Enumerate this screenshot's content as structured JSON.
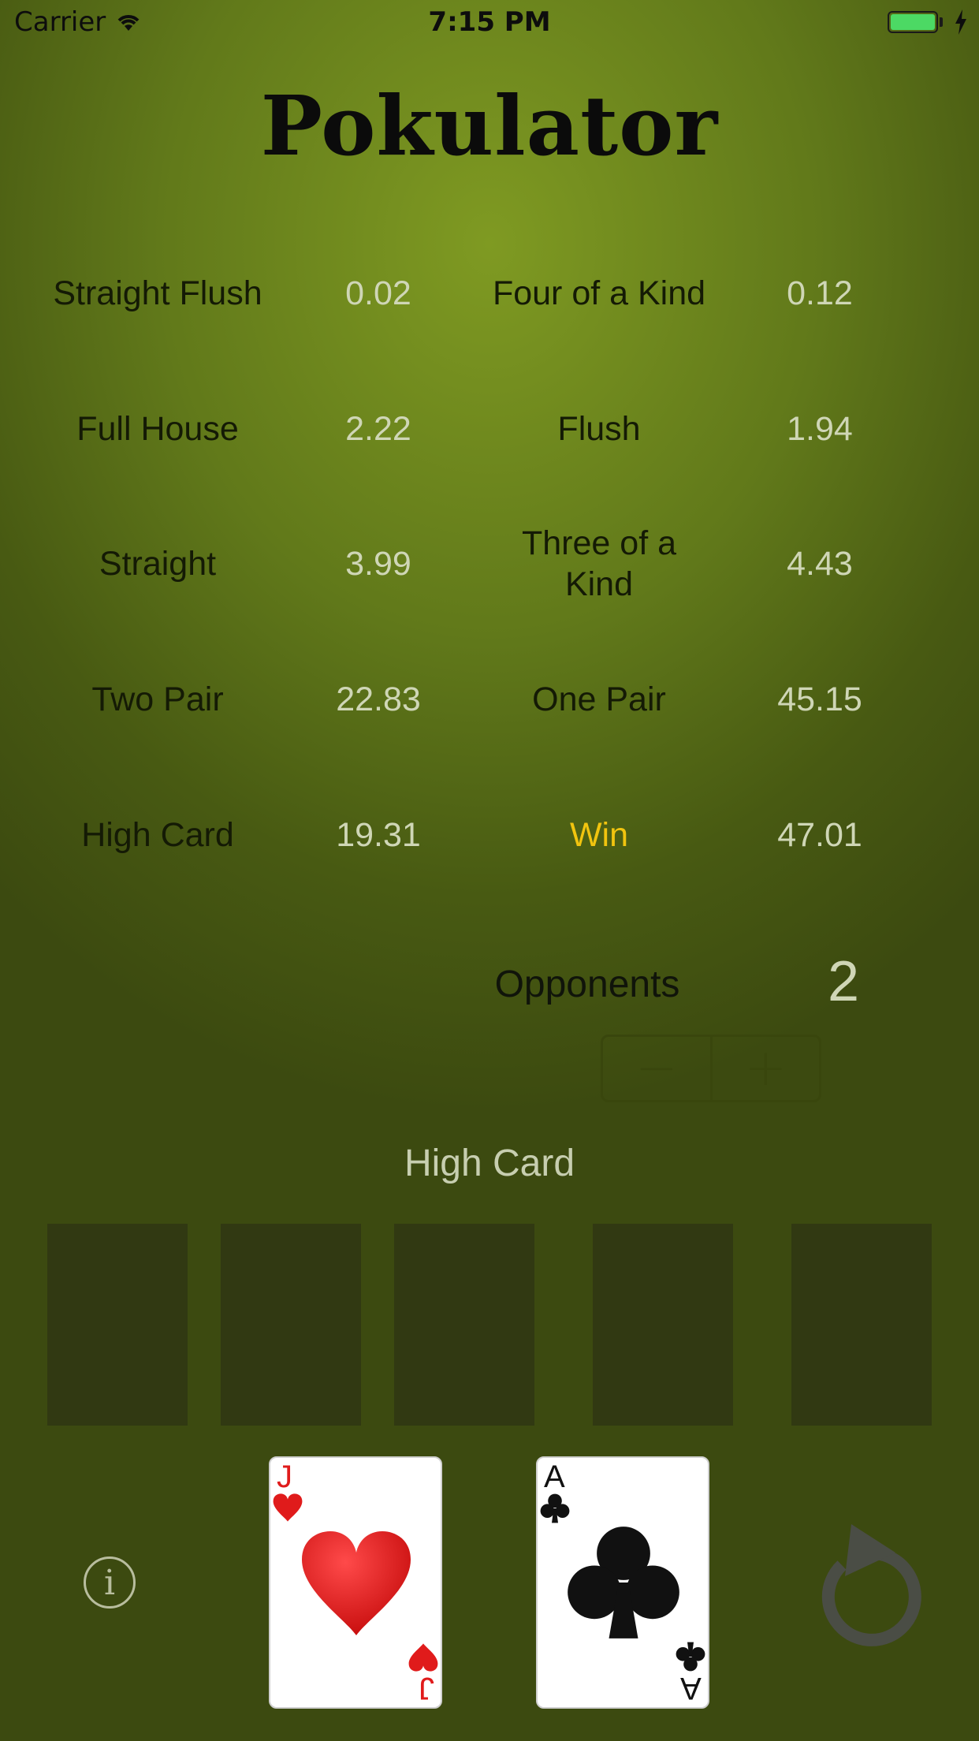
{
  "status_bar": {
    "carrier": "Carrier",
    "time": "7:15 PM",
    "battery_color": "#4cd964"
  },
  "app_title": "Pokulator",
  "odds": [
    {
      "label": "Straight Flush",
      "value": "0.02"
    },
    {
      "label": "Four of a Kind",
      "value": "0.12"
    },
    {
      "label": "Full House",
      "value": "2.22"
    },
    {
      "label": "Flush",
      "value": "1.94"
    },
    {
      "label": "Straight",
      "value": "3.99"
    },
    {
      "label": "Three of a Kind",
      "value": "4.43"
    },
    {
      "label": "Two Pair",
      "value": "22.83"
    },
    {
      "label": "One Pair",
      "value": "45.15"
    },
    {
      "label": "High Card",
      "value": "19.31"
    },
    {
      "label": "Win",
      "value": "47.01"
    }
  ],
  "accent_color": "#f1c40f",
  "opponents": {
    "label": "Opponents",
    "value": "2",
    "decrement": "−",
    "increment": "+"
  },
  "current_hand": "High Card",
  "community_slots": [
    "empty",
    "empty",
    "empty",
    "empty",
    "empty"
  ],
  "hole_cards": [
    {
      "rank": "J",
      "suit": "heart",
      "suit_symbol": "♥",
      "color": "#e01b1b"
    },
    {
      "rank": "A",
      "suit": "club",
      "suit_symbol": "♣",
      "color": "#111111"
    }
  ],
  "icons": {
    "info": "info-icon",
    "reset": "reset-icon",
    "wifi": "wifi-icon",
    "battery": "battery-icon",
    "charging": "charging-bolt-icon"
  }
}
